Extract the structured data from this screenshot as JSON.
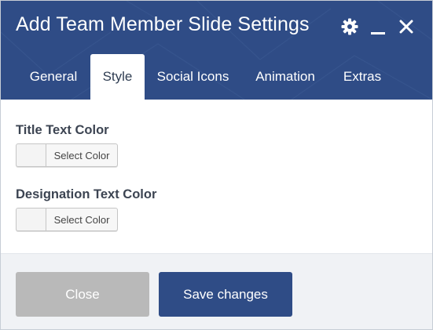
{
  "dialog": {
    "title": "Add Team Member Slide Settings"
  },
  "header_icons": [
    "gear-icon",
    "minimize-icon",
    "close-icon"
  ],
  "tabs": [
    {
      "label": "General",
      "active": false
    },
    {
      "label": "Style",
      "active": true
    },
    {
      "label": "Social Icons",
      "active": false
    },
    {
      "label": "Animation",
      "active": false
    },
    {
      "label": "Extras",
      "active": false
    }
  ],
  "fields": {
    "title_color": {
      "label": "Title Text Color",
      "button": "Select Color"
    },
    "designation_color": {
      "label": "Designation Text Color",
      "button": "Select Color"
    }
  },
  "footer": {
    "close_label": "Close",
    "save_label": "Save changes"
  },
  "colors": {
    "header_bg": "#2f4c86",
    "save_button": "#2f4c86",
    "close_button": "#b9b9b9"
  }
}
